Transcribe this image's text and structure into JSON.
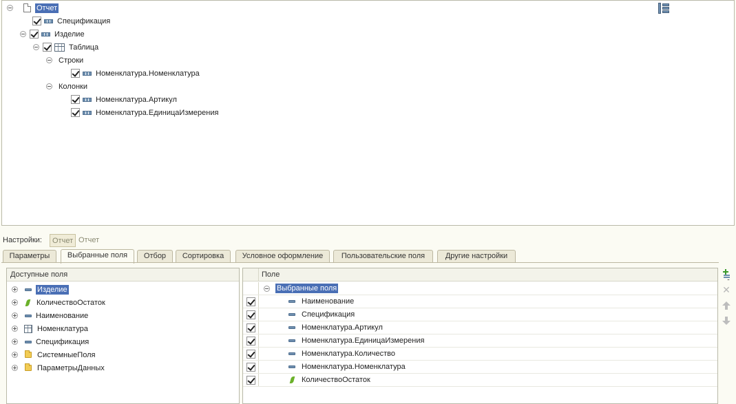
{
  "tree": {
    "root": "Отчет",
    "specification": "Спецификация",
    "item": "Изделие",
    "table": "Таблица",
    "rows": "Строки",
    "rows_field": "Номенклатура.Номенклатура",
    "columns": "Колонки",
    "col_field_1": "Номенклатура.Артикул",
    "col_field_2": "Номенклатура.ЕдиницаИзмерения"
  },
  "settings": {
    "label": "Настройки:",
    "pill_active": "Отчет",
    "pill_inactive": "Отчет"
  },
  "tabs": [
    "Параметры",
    "Выбранные поля",
    "Отбор",
    "Сортировка",
    "Условное оформление",
    "Пользовательские поля",
    "Другие настройки"
  ],
  "available": {
    "header": "Доступные поля",
    "items": [
      {
        "label": "Изделие",
        "icon": "field-icon"
      },
      {
        "label": "КоличествоОстаток",
        "icon": "resource-icon"
      },
      {
        "label": "Наименование",
        "icon": "field-icon"
      },
      {
        "label": "Номенклатура",
        "icon": "table-icon"
      },
      {
        "label": "Спецификация",
        "icon": "field-icon"
      },
      {
        "label": "СистемныеПоля",
        "icon": "folder-icon"
      },
      {
        "label": "ПараметрыДанных",
        "icon": "folder-icon"
      }
    ]
  },
  "selected": {
    "header": "Поле",
    "group": "Выбранные поля",
    "items": [
      {
        "label": "Наименование",
        "checked": true,
        "icon": "field-icon"
      },
      {
        "label": "Спецификация",
        "checked": true,
        "icon": "field-icon"
      },
      {
        "label": "Номенклатура.Артикул",
        "checked": true,
        "icon": "field-icon"
      },
      {
        "label": "Номенклатура.ЕдиницаИзмерения",
        "checked": true,
        "icon": "field-icon"
      },
      {
        "label": "Номенклатура.Количество",
        "checked": true,
        "icon": "field-icon"
      },
      {
        "label": "Номенклатура.Номенклатура",
        "checked": true,
        "icon": "field-icon"
      },
      {
        "label": "КоличествоОстаток",
        "checked": true,
        "icon": "resource-icon"
      }
    ]
  },
  "toolbar_icons": [
    "add-field-icon",
    "delete-icon",
    "move-up-icon",
    "move-down-icon"
  ],
  "colors": {
    "selection": "#4a6fb5",
    "background": "#fbfbf3",
    "resource": "#6bb12a",
    "folder": "#f2cc55"
  }
}
